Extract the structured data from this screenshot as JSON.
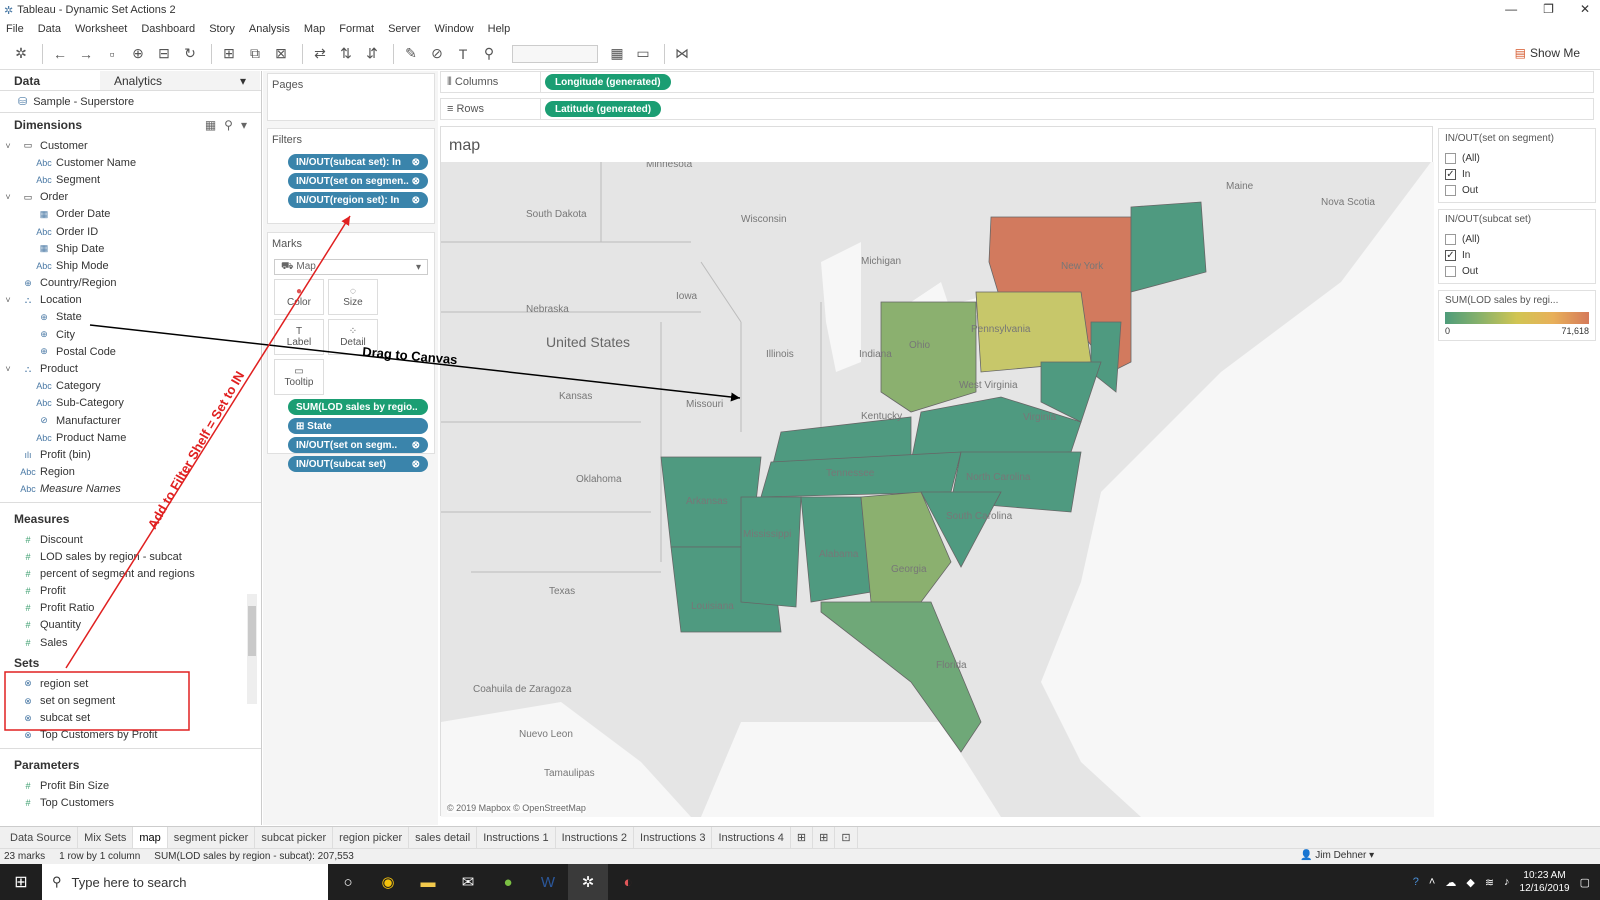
{
  "window": {
    "title": "Tableau - Dynamic Set Actions 2",
    "controls": [
      "—",
      "❐",
      "✕"
    ]
  },
  "menu": [
    "File",
    "Data",
    "Worksheet",
    "Dashboard",
    "Story",
    "Analysis",
    "Map",
    "Format",
    "Server",
    "Window",
    "Help"
  ],
  "toolbar": {
    "show_me": "Show Me"
  },
  "data_pane": {
    "tab_data": "Data",
    "tab_analytics": "Analytics",
    "datasource": "Sample - Superstore",
    "dimensions_header": "Dimensions",
    "dimensions": [
      {
        "label": "Customer",
        "level": 0,
        "type": "folder"
      },
      {
        "label": "Customer Name",
        "level": 1,
        "type": "abc"
      },
      {
        "label": "Segment",
        "level": 1,
        "type": "abc"
      },
      {
        "label": "Order",
        "level": 0,
        "type": "folder"
      },
      {
        "label": "Order Date",
        "level": 1,
        "type": "date"
      },
      {
        "label": "Order ID",
        "level": 1,
        "type": "abc"
      },
      {
        "label": "Ship Date",
        "level": 1,
        "type": "date"
      },
      {
        "label": "Ship Mode",
        "level": 1,
        "type": "abc"
      },
      {
        "label": "Country/Region",
        "level": 0,
        "type": "geo"
      },
      {
        "label": "Location",
        "level": 0,
        "type": "hier"
      },
      {
        "label": "State",
        "level": 1,
        "type": "geo"
      },
      {
        "label": "City",
        "level": 1,
        "type": "geo"
      },
      {
        "label": "Postal Code",
        "level": 1,
        "type": "geo"
      },
      {
        "label": "Product",
        "level": 0,
        "type": "hier"
      },
      {
        "label": "Category",
        "level": 1,
        "type": "abc"
      },
      {
        "label": "Sub-Category",
        "level": 1,
        "type": "abc"
      },
      {
        "label": "Manufacturer",
        "level": 1,
        "type": "link"
      },
      {
        "label": "Product Name",
        "level": 1,
        "type": "abc"
      },
      {
        "label": "Profit (bin)",
        "level": 0,
        "type": "bin"
      },
      {
        "label": "Region",
        "level": 0,
        "type": "abc"
      },
      {
        "label": "Measure Names",
        "level": 0,
        "type": "abc"
      }
    ],
    "measures_header": "Measures",
    "measures": [
      "Discount",
      "LOD sales by region - subcat",
      "percent of segment and regions",
      "Profit",
      "Profit Ratio",
      "Quantity",
      "Sales"
    ],
    "sets_header": "Sets",
    "sets": [
      "region set",
      "set on segment",
      "subcat set",
      "Top Customers by Profit"
    ],
    "parameters_header": "Parameters",
    "parameters": [
      "Profit Bin Size",
      "Top Customers"
    ]
  },
  "cards": {
    "pages": "Pages",
    "filters": "Filters",
    "filter_pills": [
      "IN/OUT(subcat set): In",
      "IN/OUT(set on segmen..",
      "IN/OUT(region set): In"
    ],
    "marks": "Marks",
    "mark_type": "Map",
    "mark_buttons": [
      "Color",
      "Size",
      "Label",
      "Detail",
      "Tooltip"
    ],
    "mark_pills": [
      "SUM(LOD sales by regio..",
      "State",
      "IN/OUT(set on segm..",
      "IN/OUT(subcat set)"
    ]
  },
  "shelves": {
    "columns_label": "Columns",
    "columns_pill": "Longitude (generated)",
    "rows_label": "Rows",
    "rows_pill": "Latitude (generated)"
  },
  "viz": {
    "title": "map",
    "copyright": "© 2019 Mapbox © OpenStreetMap",
    "map_labels": [
      "Minnesota",
      "South Dakota",
      "Wisconsin",
      "Michigan",
      "Maine",
      "Nova Scotia",
      "Nebraska",
      "Iowa",
      "United States",
      "Illinois",
      "Indiana",
      "Ohio",
      "Pennsylvania",
      "New York",
      "West Virginia",
      "Virginia",
      "Kansas",
      "Missouri",
      "Kentucky",
      "Tennessee",
      "North Carolina",
      "Oklahoma",
      "Arkansas",
      "Mississippi",
      "Alabama",
      "Georgia",
      "South Carolina",
      "Texas",
      "Louisiana",
      "Florida",
      "Coahuila de Zaragoza",
      "Nuevo Leon",
      "Tamaulipas"
    ]
  },
  "legends": {
    "seg_title": "IN/OUT(set on segment)",
    "seg_opts": [
      "(All)",
      "In",
      "Out"
    ],
    "sub_title": "IN/OUT(subcat set)",
    "sub_opts": [
      "(All)",
      "In",
      "Out"
    ],
    "color_title": "SUM(LOD sales by regi...",
    "color_min": "0",
    "color_max": "71,618"
  },
  "annotations": {
    "drag": "Drag to Canvas",
    "filter": "Add to Filter Shelf = Set to IN"
  },
  "sheet_tabs": [
    "Data Source",
    "Mix Sets",
    "map",
    "segment picker",
    "subcat picker",
    "region picker",
    "sales detail",
    "Instructions 1",
    "Instructions 2",
    "Instructions 3",
    "Instructions 4"
  ],
  "status": {
    "marks": "23 marks",
    "rows": "1 row by 1 column",
    "sum": "SUM(LOD sales by region - subcat): 207,553",
    "user": "Jim Dehner"
  },
  "taskbar": {
    "search": "Type here to search",
    "time": "10:23 AM",
    "date": "12/16/2019"
  },
  "colors": {
    "high": "#d27a5e",
    "midhigh": "#c7c76a",
    "mid": "#8bb06f",
    "low": "#4f9a80",
    "accent": "#1b9e73",
    "pillblue": "#3a84ab",
    "annotation": "#e02020"
  }
}
